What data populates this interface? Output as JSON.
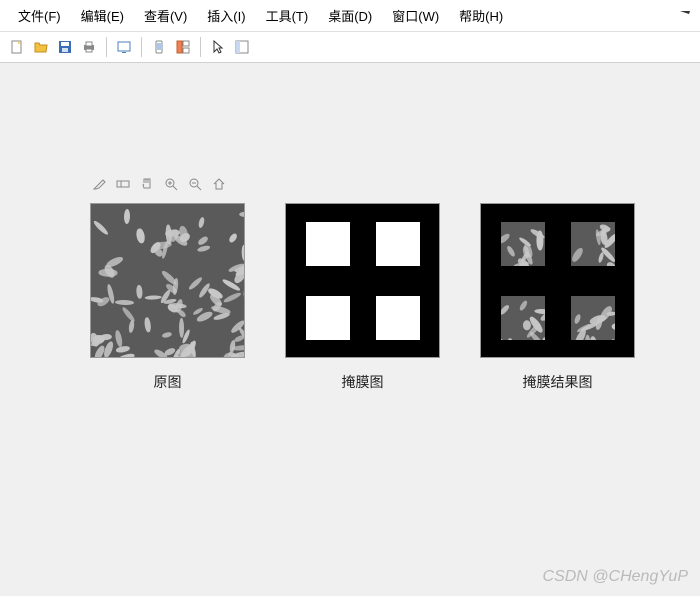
{
  "menu": {
    "file": "文件(F)",
    "edit": "编辑(E)",
    "view": "查看(V)",
    "insert": "插入(I)",
    "tools": "工具(T)",
    "desktop": "桌面(D)",
    "window": "窗口(W)",
    "help": "帮助(H)"
  },
  "figures": {
    "fig1_label": "原图",
    "fig2_label": "掩膜图",
    "fig3_label": "掩膜结果图"
  },
  "watermark": "CSDN @CHengYuP"
}
